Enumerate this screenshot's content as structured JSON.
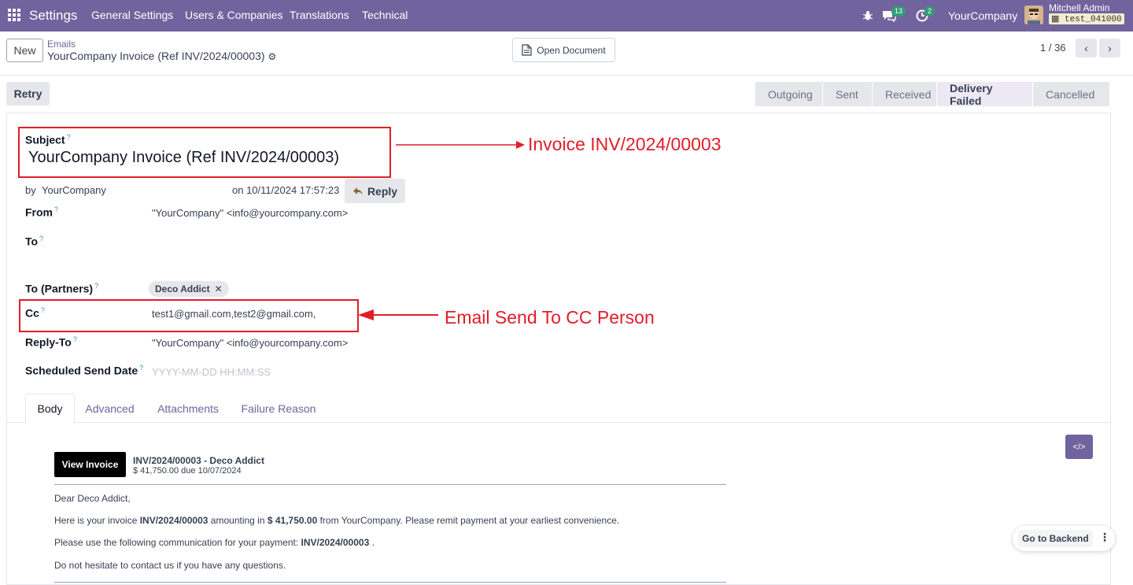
{
  "topbar": {
    "app_title": "Settings",
    "menus": [
      "General Settings",
      "Users & Companies",
      "Translations",
      "Technical"
    ],
    "messages_count": "13",
    "activities_count": "2",
    "company": "YourCompany",
    "user_name": "Mitchell Admin",
    "db_name": "test_041000"
  },
  "control_panel": {
    "new_label": "New",
    "breadcrumb_parent": "Emails",
    "breadcrumb_current": "YourCompany Invoice (Ref INV/2024/00003)",
    "open_document_label": "Open Document",
    "pager": "1 / 36"
  },
  "statusbar": {
    "retry_label": "Retry",
    "stages": [
      "Outgoing",
      "Sent",
      "Received",
      "Delivery Failed",
      "Cancelled"
    ],
    "active_stage": "Delivery Failed"
  },
  "form": {
    "subject_label": "Subject",
    "subject_value": "YourCompany Invoice (Ref INV/2024/00003)",
    "by_prefix": "by",
    "author": "YourCompany",
    "date_text": "on 10/11/2024 17:57:23",
    "reply_label": "Reply",
    "from_label": "From",
    "from_value": "\"YourCompany\" <info@yourcompany.com>",
    "to_label": "To",
    "to_partners_label": "To (Partners)",
    "partner_tag": "Deco Addict",
    "cc_label": "Cc",
    "cc_value": "test1@gmail.com,test2@gmail.com,",
    "reply_to_label": "Reply-To",
    "reply_to_value": "\"YourCompany\" <info@yourcompany.com>",
    "scheduled_label": "Scheduled Send Date",
    "scheduled_placeholder": "YYYY-MM-DD HH:MM:SS",
    "help_mark": "?"
  },
  "tabs": [
    "Body",
    "Advanced",
    "Attachments",
    "Failure Reason"
  ],
  "body": {
    "view_invoice_label": "View Invoice",
    "invoice_title": "INV/2024/00003 - Deco Addict",
    "invoice_sub": "$ 41,750.00 due 10/07/2024",
    "greeting": "Dear Deco Addict,",
    "p1_a": "Here is your invoice ",
    "p1_b": "INV/2024/00003",
    "p1_c": " amounting in ",
    "p1_d": "$ 41,750.00",
    "p1_e": " from YourCompany. Please remit payment at your earliest convenience.",
    "p2_a": "Please use the following communication for your payment: ",
    "p2_b": "INV/2024/00003",
    "p2_c": " .",
    "p3": "Do not hesitate to contact us if you have any questions."
  },
  "annotations": {
    "subject_note": "Invoice INV/2024/00003",
    "cc_note": "Email Send To CC Person",
    "color": "#e11d2a"
  },
  "go_backend_label": "Go to Backend",
  "colors": {
    "brand": "#71639e",
    "badge": "#2f9e75"
  }
}
